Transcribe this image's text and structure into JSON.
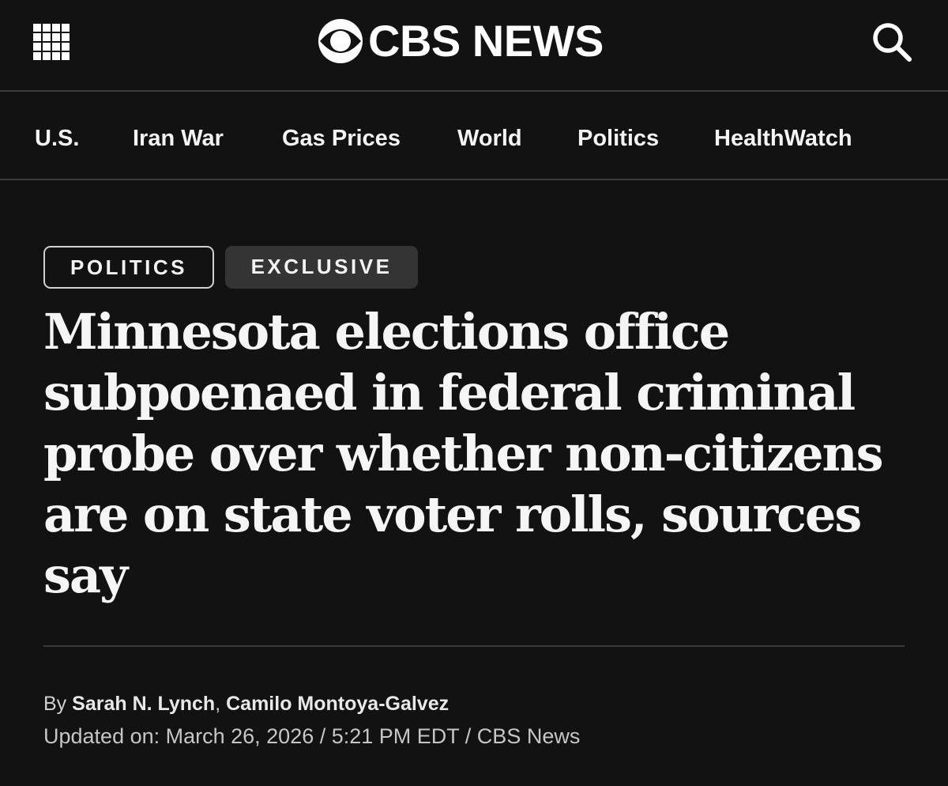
{
  "header": {
    "menu_icon": "grid-menu-icon",
    "logo_icon": "cbs-eye-icon",
    "logo_text": "CBS NEWS",
    "search_icon": "search-icon"
  },
  "nav": {
    "items": [
      {
        "label": "U.S."
      },
      {
        "label": "Iran War"
      },
      {
        "label": "Gas Prices"
      },
      {
        "label": "World"
      },
      {
        "label": "Politics"
      },
      {
        "label": "HealthWatch"
      }
    ]
  },
  "article": {
    "tags": [
      {
        "label": "POLITICS"
      },
      {
        "label": "EXCLUSIVE"
      }
    ],
    "headline": "Minnesota elections office subpoenaed in federal criminal probe over whether non-citizens are on state voter rolls, sources say",
    "byline": {
      "prefix": "By",
      "authors": [
        "Sarah N. Lynch",
        "Camilo Montoya-Galvez"
      ],
      "separator": ","
    },
    "updated": "Updated on: March 26, 2026 / 5:21 PM EDT / CBS News"
  },
  "colors": {
    "background": "#121212",
    "text": "#f2f2f2",
    "divider": "#3a3a3a",
    "tag_fill": "#343434"
  }
}
